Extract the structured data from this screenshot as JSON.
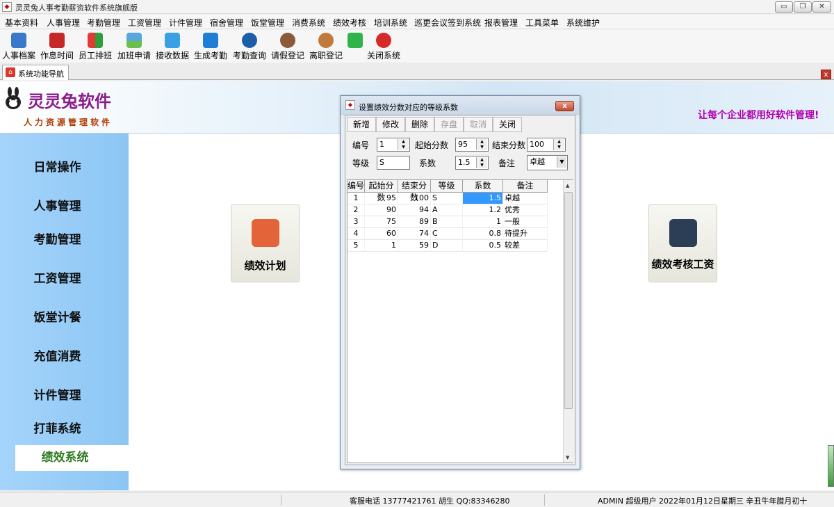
{
  "window": {
    "title": "灵灵兔人事考勤薪资软件系统旗舰版",
    "min_glyph": "▭",
    "max_glyph": "❐",
    "close_glyph": "✕"
  },
  "menu": [
    "基本资料",
    "人事管理",
    "考勤管理",
    "工资管理",
    "计件管理",
    "宿舍管理",
    "饭堂管理",
    "消费系统",
    "绩效考核",
    "培训系统",
    "巡更会议签到系统",
    "报表管理",
    "工具菜单",
    "系统维护"
  ],
  "toolbar": [
    {
      "label": "人事档案",
      "icon": "people-icon",
      "color": "#3a78c9"
    },
    {
      "label": "作息时间",
      "icon": "clock-icon",
      "color": "#c62828"
    },
    {
      "label": "员工排班",
      "icon": "grid-icon",
      "color": "#2e9d3e"
    },
    {
      "label": "加班申请",
      "icon": "landscape-icon",
      "color": "#58a8e0"
    },
    {
      "label": "接收数据",
      "icon": "wifi-icon",
      "color": "#3aa0e6"
    },
    {
      "label": "生成考勤",
      "icon": "dropbox-icon",
      "color": "#1f7fd6"
    },
    {
      "label": "考勤查询",
      "icon": "search-icon",
      "color": "#1c5fa8"
    },
    {
      "label": "请假登记",
      "icon": "camera-icon",
      "color": "#8a5a3a"
    },
    {
      "label": "离职登记",
      "icon": "user-icon",
      "color": "#c07a3a"
    },
    {
      "label": "",
      "icon": "wechat-icon",
      "color": "#2fb34a"
    },
    {
      "label": "关闭系统",
      "icon": "power-icon",
      "color": "#d62a2a"
    }
  ],
  "tab": {
    "label": "系统功能导航",
    "close_glyph": "x"
  },
  "banner": {
    "brand": "灵灵兔软件",
    "subtitle": "人力资源管理软件",
    "slogan": "让每个企业都用好软件管理!"
  },
  "sidebar": {
    "items": [
      "日常操作",
      "人事管理",
      "考勤管理",
      "工资管理",
      "饭堂计餐",
      "充值消费",
      "计件管理",
      "打菲系统",
      "绩效系统"
    ],
    "active_index": 8
  },
  "tiles": [
    {
      "label": "绩效计划",
      "icon": "plan-icon",
      "color": "#e4643a"
    },
    {
      "label": "绩效考核工资",
      "icon": "salary-s-icon",
      "color": "#2c3e56"
    }
  ],
  "dialog": {
    "title": "设置绩效分数对应的等级系数",
    "close_glyph": "x",
    "buttons": [
      {
        "label": "新增",
        "enabled": true
      },
      {
        "label": "修改",
        "enabled": true
      },
      {
        "label": "删除",
        "enabled": true
      },
      {
        "label": "存盘",
        "enabled": false
      },
      {
        "label": "取消",
        "enabled": false
      },
      {
        "label": "关闭",
        "enabled": true
      }
    ],
    "form": {
      "id_label": "编号",
      "id_value": "1",
      "start_label": "起始分数",
      "start_value": "95",
      "end_label": "结束分数",
      "end_value": "100",
      "grade_label": "等级",
      "grade_value": "S",
      "coef_label": "系数",
      "coef_value": "1.5",
      "note_label": "备注",
      "note_value": "卓越"
    },
    "table": {
      "headers": [
        "编号",
        "起始分数",
        "结束分数",
        "等级",
        "系数",
        "备注"
      ],
      "rows": [
        [
          "1",
          "95",
          "100",
          "S",
          "1.5",
          "卓越"
        ],
        [
          "2",
          "90",
          "94",
          "A",
          "1.2",
          "优秀"
        ],
        [
          "3",
          "75",
          "89",
          "B",
          "1",
          "一般"
        ],
        [
          "4",
          "60",
          "74",
          "C",
          "0.8",
          "待提升"
        ],
        [
          "5",
          "1",
          "59",
          "D",
          "0.5",
          "较差"
        ]
      ],
      "selected_row": 0
    }
  },
  "status": {
    "contact": "客服电话 13777421761 胡生 QQ:83346280",
    "user": "ADMIN 超级用户 2022年01月12日星期三 辛丑牛年腊月初十"
  }
}
